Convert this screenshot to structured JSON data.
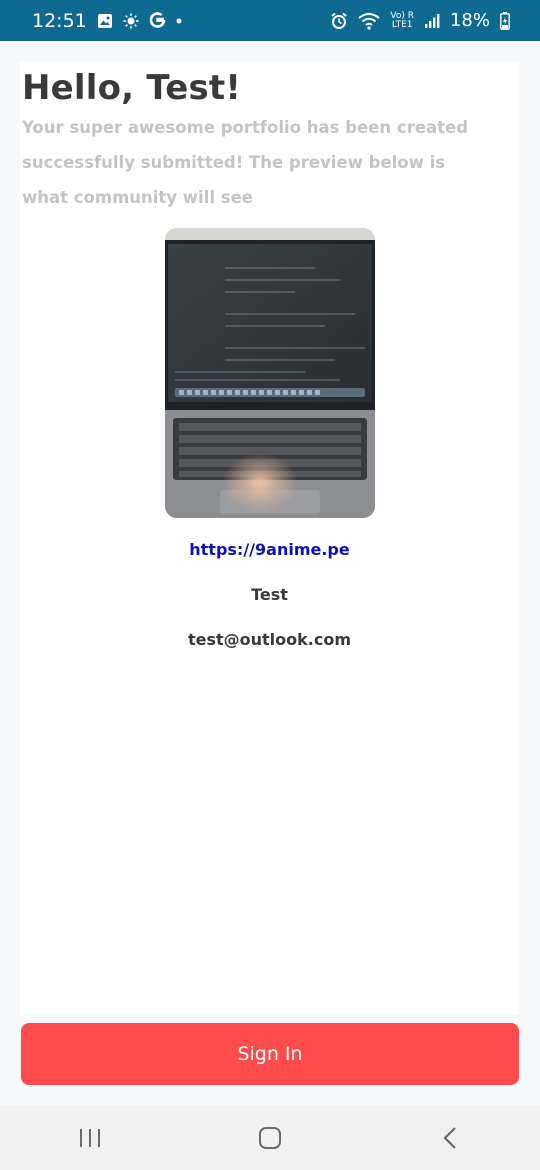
{
  "status_bar": {
    "time": "12:51",
    "battery": "18%",
    "icons": [
      "image-icon",
      "brightness-icon",
      "google-icon",
      "dot-icon",
      "alarm-icon",
      "wifi-icon",
      "volte-icon",
      "signal-icon",
      "battery-icon"
    ],
    "network_label_top": "Vo) R",
    "network_label_bottom": "LTE1"
  },
  "main": {
    "title": "Hello, Test!",
    "subtitle": "Your super awesome portfolio has been created successfully submitted! The preview below is what community will see",
    "preview_image": "laptop-photo",
    "link": "https://9anime.pe",
    "name": "Test",
    "email": "test@outlook.com"
  },
  "footer": {
    "signin_label": "Sign In"
  },
  "nav_bar": {
    "items": [
      "recents-icon",
      "home-icon",
      "back-icon"
    ]
  },
  "colors": {
    "status_bar": "#0e6a91",
    "button": "#ff4b4b",
    "link": "#1010b8",
    "title": "#3a3a3a",
    "subtitle": "#c4c4c4"
  }
}
